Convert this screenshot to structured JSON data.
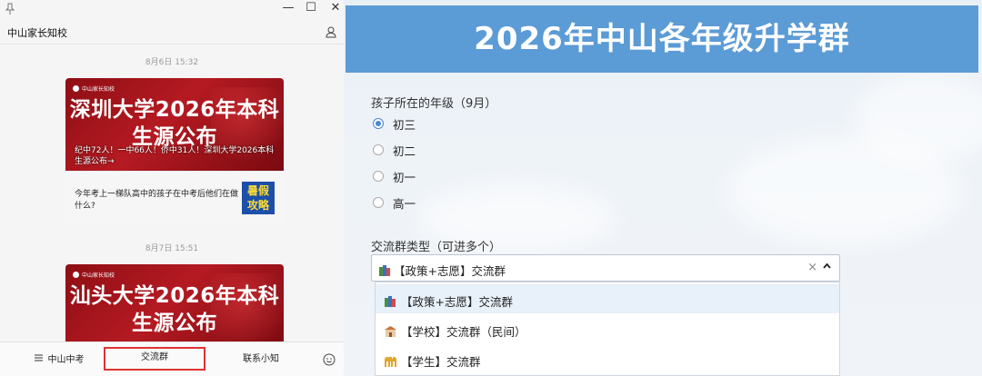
{
  "left": {
    "header_name": "中山家长知校",
    "window_controls": [
      "—",
      "☐",
      "✕"
    ],
    "messages": [
      {
        "time": "8月6日 15:32",
        "banner_logo": "中山家长知校",
        "banner_title_1": "深圳大学2026年本科",
        "banner_title_2": "生源公布",
        "overlay_1": "纪中72人！一中66人！侨中31人！深圳大学2026本科",
        "overlay_2": "生源公布→",
        "sub_text": "今年考上一梯队高中的孩子在中考后他们在做什么?",
        "thumb_1": "暑假",
        "thumb_2": "攻略"
      },
      {
        "time": "8月7日 15:51",
        "banner_logo": "中山家长知校",
        "banner_title_1": "汕头大学2026年本科",
        "banner_title_2": "生源公布"
      }
    ],
    "bottom_menu": [
      {
        "label": "中山中考",
        "icon": "menu-icon"
      },
      {
        "label": "交流群"
      },
      {
        "label": "联系小知"
      }
    ]
  },
  "form": {
    "title": "2026年中山各年级升学群",
    "q1_label": "孩子所在的年级（9月）",
    "grades": [
      {
        "label": "初三",
        "selected": true
      },
      {
        "label": "初二",
        "selected": false
      },
      {
        "label": "初一",
        "selected": false
      },
      {
        "label": "高一",
        "selected": false
      }
    ],
    "q2_label": "交流群类型（可进多个）",
    "select_value": "【政策+志愿】交流群",
    "clear_symbol": "×",
    "options": [
      {
        "label": "【政策+志愿】交流群",
        "icon": "books-icon"
      },
      {
        "label": "【学校】交流群（民间）",
        "icon": "school-icon"
      },
      {
        "label": "【学生】交流群",
        "icon": "raised-hands-icon"
      }
    ],
    "colors": {
      "header": "#5b9bd6",
      "radio": "#4a86d0",
      "highlight": "#d33333"
    }
  }
}
